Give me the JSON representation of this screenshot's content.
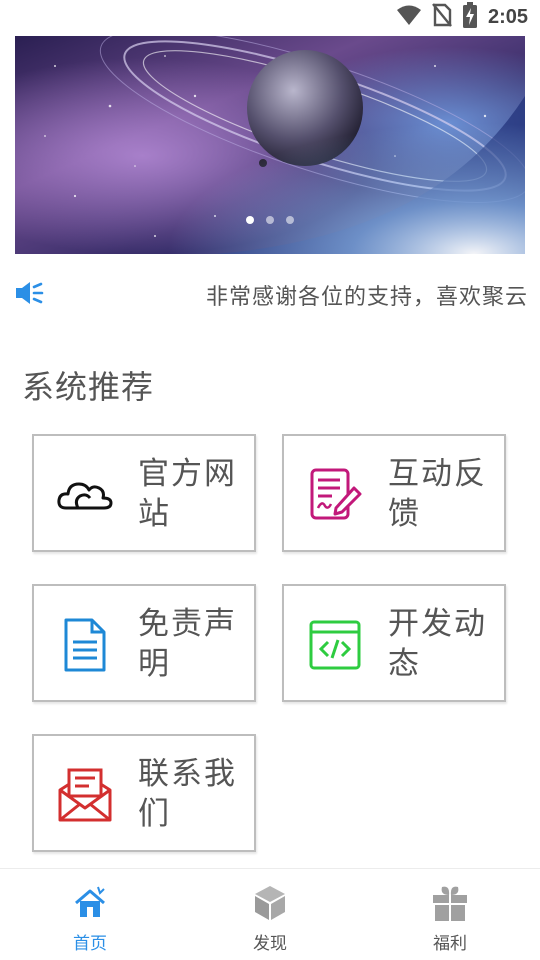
{
  "status_bar": {
    "time": "2:05",
    "icons": [
      "wifi-icon",
      "no-sim-icon",
      "battery-charging-icon"
    ]
  },
  "banner": {
    "image": "planet-with-rings-space-scene",
    "pages": 3,
    "active_page": 1
  },
  "notice": {
    "icon": "speaker-icon",
    "text": "非常感谢各位的支持，喜欢聚云"
  },
  "section": {
    "title": "系统推荐"
  },
  "cards": [
    {
      "label": "官方网站",
      "icon": "cloud-icon",
      "color": "#111111"
    },
    {
      "label": "互动反馈",
      "icon": "feedback-edit-icon",
      "color": "#c2187a"
    },
    {
      "label": "免责声明",
      "icon": "document-icon",
      "color": "#1e88d6"
    },
    {
      "label": "开发动态",
      "icon": "code-window-icon",
      "color": "#2ecc40"
    },
    {
      "label": "联系我们",
      "icon": "mail-icon",
      "color": "#d32f2f"
    }
  ],
  "tabs": [
    {
      "label": "首页",
      "icon": "home-icon",
      "active": true
    },
    {
      "label": "发现",
      "icon": "cube-icon",
      "active": false
    },
    {
      "label": "福利",
      "icon": "gift-icon",
      "active": false
    }
  ],
  "colors": {
    "accent": "#2b8fe6",
    "inactive_icon": "#a0a0a0"
  }
}
